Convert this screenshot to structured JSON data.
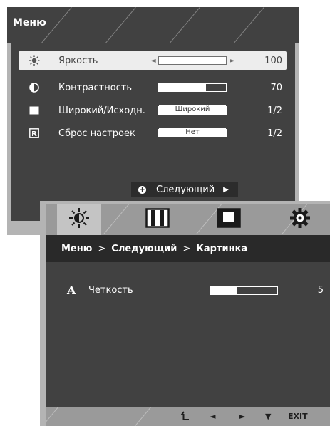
{
  "menu": {
    "title": "Меню",
    "items": [
      {
        "icon": "sun-icon",
        "label": "Яркость",
        "value": "100",
        "fill": 1.0,
        "selected": true
      },
      {
        "icon": "contrast-icon",
        "label": "Контрастность",
        "value": "70",
        "fill": 0.7
      },
      {
        "icon": "rectangle-icon",
        "label": "Широкий/Исходн.",
        "value": "1/2",
        "option": "Широкий"
      },
      {
        "icon": "reset-icon",
        "label": "Сброс настроек",
        "value": "1/2",
        "option": "Нет"
      }
    ],
    "next_label": "Следующий",
    "reset_glyph": "R"
  },
  "submenu": {
    "tabs": [
      "sun-icon",
      "picture-icon",
      "screen-icon",
      "gear-icon"
    ],
    "breadcrumb": [
      "Меню",
      "Следующий",
      "Картинка"
    ],
    "separator": ">",
    "sharpness": {
      "glyph": "A",
      "label": "Четкость",
      "value": "5",
      "fill": 0.4
    },
    "footer": {
      "arrow_left": "◄",
      "arrow_right": "►",
      "arrow_down": "▼",
      "exit": "EXIT"
    }
  }
}
